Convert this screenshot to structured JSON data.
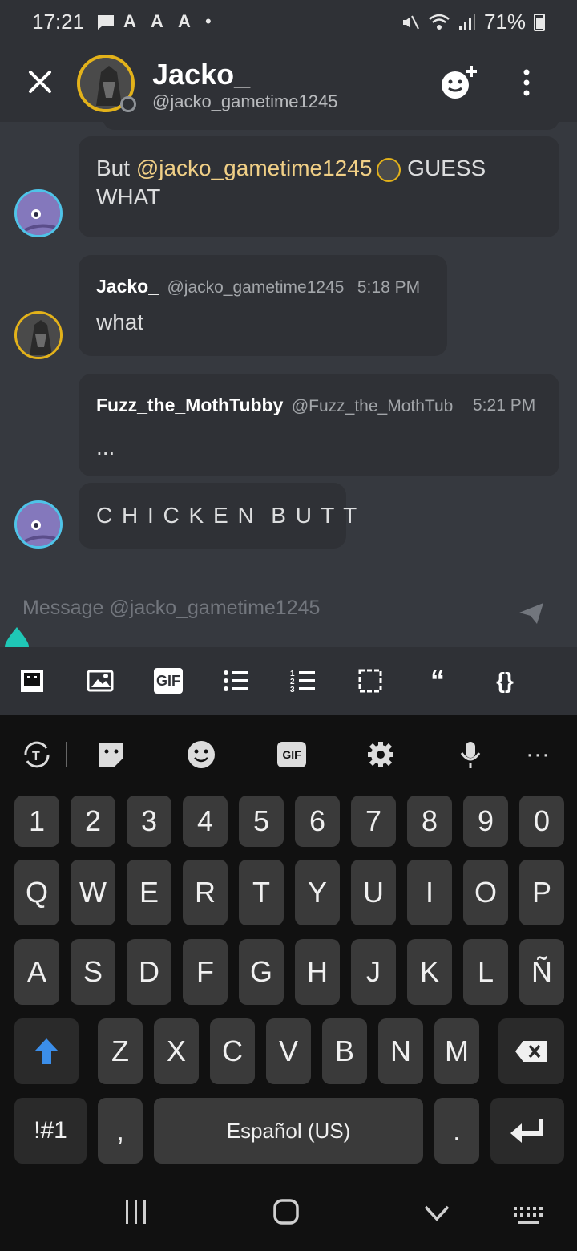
{
  "status_bar": {
    "time": "17:21",
    "notification_icons": [
      "message-icon",
      "a-icon",
      "a-icon",
      "a-icon",
      "dot-icon"
    ],
    "battery_percent": "71%"
  },
  "header": {
    "name": "Jacko_",
    "handle": "@jacko_gametime1245"
  },
  "messages": [
    {
      "text_before": "But ",
      "mention": "@jacko_gametime1245",
      "text_after": " GUESS WHAT"
    },
    {
      "author": "Jacko_",
      "handle": "@jacko_gametime1245",
      "time": "5:18 PM",
      "text": "what"
    },
    {
      "author": "Fuzz_the_MothTubby",
      "handle": "@Fuzz_the_MothTub",
      "time": "5:21 PM",
      "text": "..."
    },
    {
      "text": "C H I C K E N  B U T T"
    }
  ],
  "composer": {
    "placeholder": "Message @jacko_gametime1245"
  },
  "format_bar": {
    "gif_label": "GIF",
    "quote_label": "“",
    "code_label": "{}"
  },
  "keyboard": {
    "toolbar_gif_label": "GIF",
    "row_numbers": [
      "1",
      "2",
      "3",
      "4",
      "5",
      "6",
      "7",
      "8",
      "9",
      "0"
    ],
    "row_1": [
      "Q",
      "W",
      "E",
      "R",
      "T",
      "Y",
      "U",
      "I",
      "O",
      "P"
    ],
    "row_2": [
      "A",
      "S",
      "D",
      "F",
      "G",
      "H",
      "J",
      "K",
      "L",
      "Ñ"
    ],
    "row_3": [
      "Z",
      "X",
      "C",
      "V",
      "B",
      "N",
      "M"
    ],
    "symbols_label": "!#1",
    "comma_label": ",",
    "space_label": "Español (US)",
    "period_label": "."
  },
  "colors": {
    "background": "#36393f",
    "bubble": "#2f3136",
    "mention": "#f0cf86",
    "accent_teal": "#1fc7b6",
    "avatar_ring_gold": "#e3b21a",
    "shift_blue": "#3b8eea"
  }
}
